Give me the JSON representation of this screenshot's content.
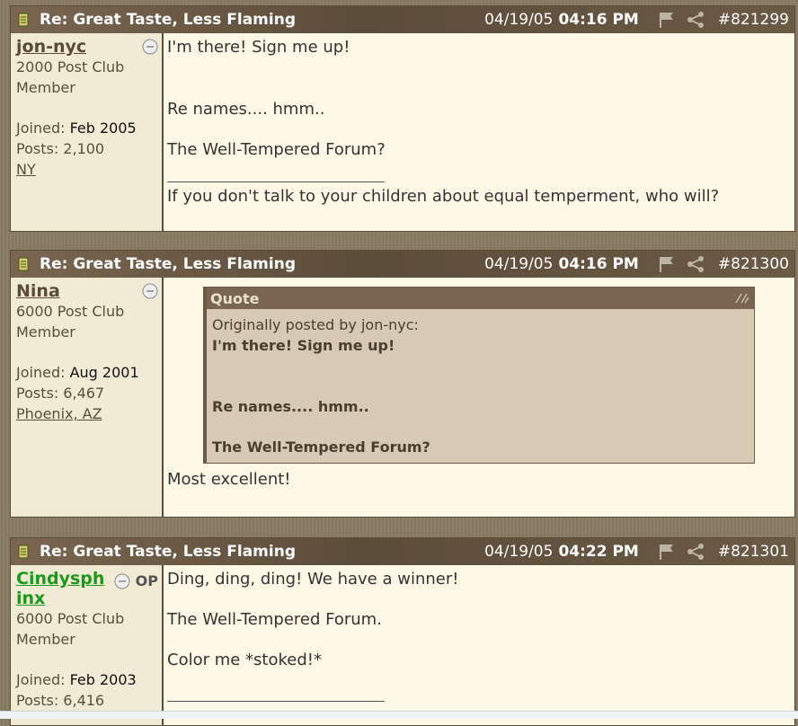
{
  "posts": [
    {
      "title": "Re: Great Taste, Less Flaming",
      "date": "04/19/05",
      "time": "04:16 PM",
      "number": "#821299",
      "author": {
        "name": "jon-nyc",
        "rank_line1": "2000 Post Club",
        "rank_line2": "Member",
        "joined_label": "Joined:",
        "joined_value": "Feb 2005",
        "posts_label": "Posts:",
        "posts_value": "2,100",
        "location": "NY"
      },
      "lines": [
        "I'm there! Sign me up!",
        "Re names.... hmm..",
        "The Well-Tempered Forum?"
      ],
      "signature": "If you don't talk to your children about equal temperment, who will?"
    },
    {
      "title": "Re: Great Taste, Less Flaming",
      "date": "04/19/05",
      "time": "04:16 PM",
      "number": "#821300",
      "author": {
        "name": "Nina",
        "rank_line1": "6000 Post Club",
        "rank_line2": "Member",
        "joined_label": "Joined:",
        "joined_value": "Aug 2001",
        "posts_label": "Posts:",
        "posts_value": "6,467",
        "location": "Phoenix, AZ"
      },
      "quote": {
        "label": "Quote",
        "attribution": "Originally posted by jon-nyc:",
        "lines": [
          "I'm there! Sign me up!",
          "Re names.... hmm..",
          "The Well-Tempered Forum?"
        ]
      },
      "lines": [
        "Most excellent!"
      ]
    },
    {
      "title": "Re: Great Taste, Less Flaming",
      "date": "04/19/05",
      "time": "04:22 PM",
      "number": "#821301",
      "author": {
        "name_part1": "Cindysph",
        "name_part2": "inx",
        "op_badge": "OP",
        "rank_line1": "6000 Post Club",
        "rank_line2": "Member",
        "joined_label": "Joined:",
        "joined_value": "Feb 2003",
        "posts_label": "Posts:",
        "posts_value": "6,416"
      },
      "lines": [
        "Ding, ding, ding! We have a winner!",
        "The Well-Tempered Forum.",
        "Color me *stoked!*"
      ]
    }
  ],
  "icons": {
    "post_icon": "document-icon",
    "flag": "flag-icon",
    "share": "share-icon",
    "status": "status-face-icon",
    "quote_expand": "expand-icon"
  },
  "colors": {
    "header_bg": "#6b5a45",
    "post_bg": "#fdf9e6",
    "author_bg": "#f1ebd6",
    "quote_bg": "#d6cab5",
    "op_name": "#1a9a1a"
  }
}
